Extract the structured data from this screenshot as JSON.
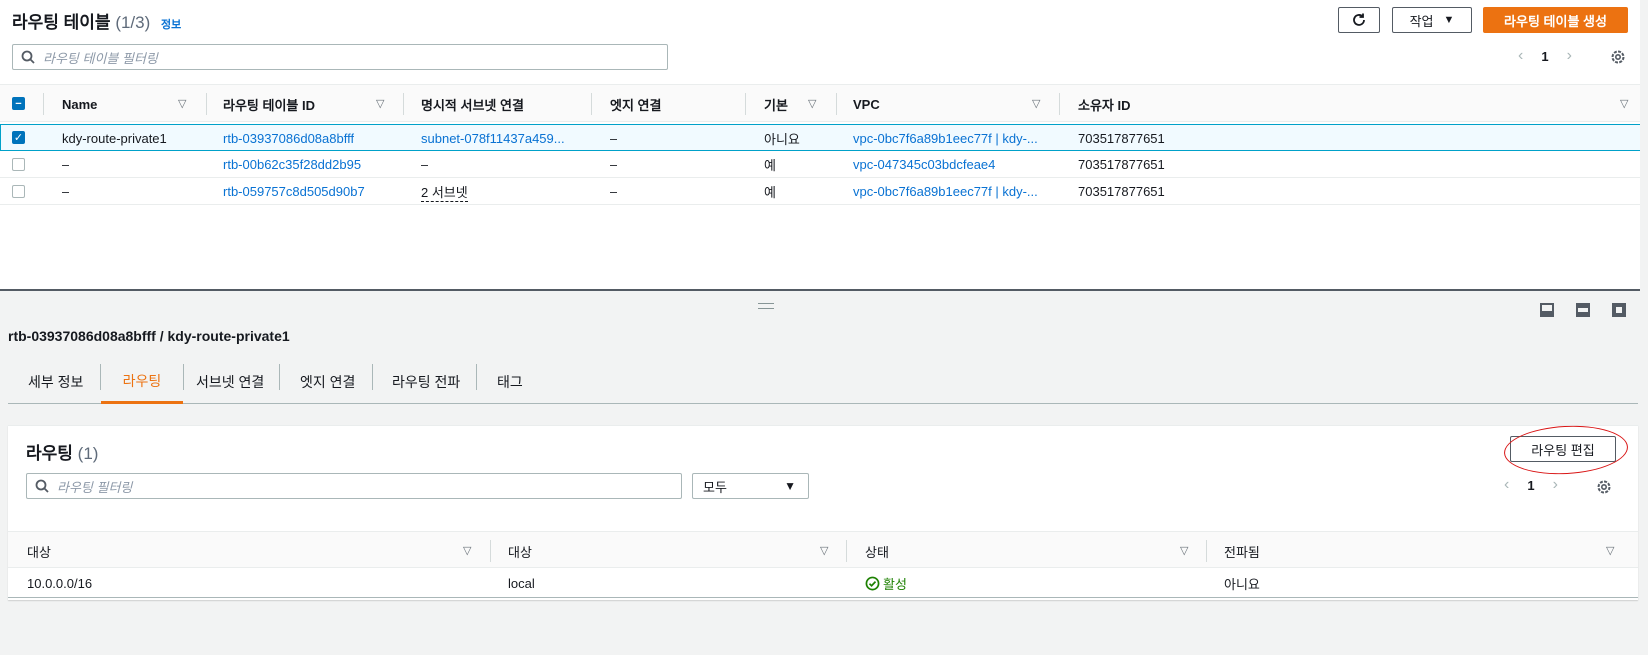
{
  "header": {
    "title": "라우팅 테이블",
    "count": "(1/3)",
    "info_link": "정보",
    "refresh_icon": "refresh-icon",
    "actions_label": "작업",
    "create_label": "라우팅 테이블 생성",
    "search_placeholder": "라우팅 테이블 필터링",
    "page": "1"
  },
  "columns": [
    "Name",
    "라우팅 테이블 ID",
    "명시적 서브넷 연결",
    "엣지 연결",
    "기본",
    "VPC",
    "소유자 ID"
  ],
  "rows": [
    {
      "name": "kdy-route-private1",
      "id": "rtb-03937086d08a8bfff",
      "subnet": "subnet-078f11437a459...",
      "edge": "–",
      "main": "아니요",
      "vpc": "vpc-0bc7f6a89b1eec77f | kdy-...",
      "owner": "703517877651"
    },
    {
      "name": "–",
      "id": "rtb-00b62c35f28dd2b95",
      "subnet": "–",
      "edge": "–",
      "main": "예",
      "vpc": "vpc-047345c03bdcfeae4",
      "owner": "703517877651"
    },
    {
      "name": "–",
      "id": "rtb-059757c8d505d90b7",
      "subnet": "2 서브넷",
      "edge": "–",
      "main": "예",
      "vpc": "vpc-0bc7f6a89b1eec77f | kdy-...",
      "owner": "703517877651"
    }
  ],
  "detail": {
    "title": "rtb-03937086d08a8bfff / kdy-route-private1",
    "tabs": [
      "세부 정보",
      "라우팅",
      "서브넷 연결",
      "엣지 연결",
      "라우팅 전파",
      "태그"
    ],
    "routes_title": "라우팅",
    "routes_count": "(1)",
    "edit_label": "라우팅 편집",
    "search_placeholder": "라우팅 필터링",
    "select_value": "모두",
    "page": "1",
    "columns": [
      "대상",
      "대상",
      "상태",
      "전파됨"
    ],
    "route": {
      "destination": "10.0.0.0/16",
      "target": "local",
      "status": "활성",
      "propagated": "아니요"
    }
  },
  "colors": {
    "primary": "#ec7211",
    "link": "#0972d3",
    "active_status": "#1d8102",
    "annotation": "#d91515"
  }
}
